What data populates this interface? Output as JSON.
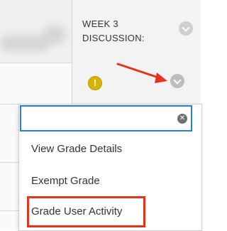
{
  "column_header": {
    "title": "WEEK 3\nDISCUSSION:",
    "menu_icon": "chevron-down-icon"
  },
  "grade_cell": {
    "status_icon": "exclamation-warning-icon",
    "menu_icon": "chevron-down-icon"
  },
  "context_menu": {
    "search": {
      "value": "",
      "placeholder": ""
    },
    "clear_icon": "close-circle-icon",
    "items": [
      {
        "label": "View Grade Details"
      },
      {
        "label": "Exempt Grade"
      },
      {
        "label": "Grade User Activity"
      }
    ]
  },
  "annotations": {
    "arrow_color": "#e8331c",
    "highlight_color": "#e8331c",
    "focus_color": "#2b7bd8"
  }
}
